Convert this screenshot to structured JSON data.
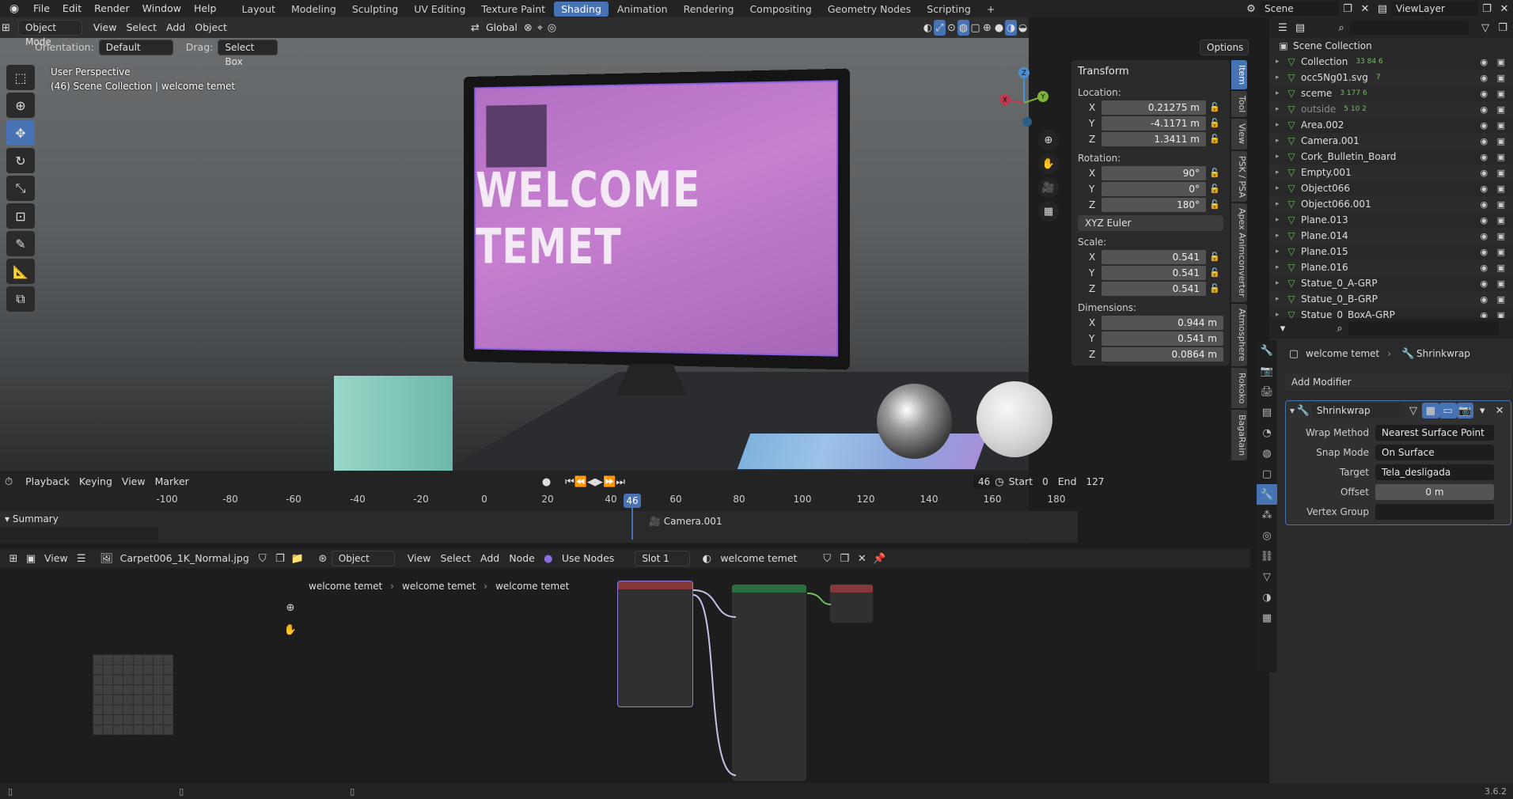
{
  "topbar": {
    "menus": [
      "File",
      "Edit",
      "Render",
      "Window",
      "Help"
    ],
    "workspaces": [
      "Layout",
      "Modeling",
      "Sculpting",
      "UV Editing",
      "Texture Paint",
      "Shading",
      "Animation",
      "Rendering",
      "Compositing",
      "Geometry Nodes",
      "Scripting"
    ],
    "active_workspace": "Shading",
    "scene": "Scene",
    "view_layer": "ViewLayer"
  },
  "viewport": {
    "mode": "Object Mode",
    "menus": [
      "View",
      "Select",
      "Add",
      "Object"
    ],
    "transform_space": "Global",
    "orientation_label": "Orientation:",
    "orientation_value": "Default",
    "drag_label": "Drag:",
    "drag_value": "Select Box",
    "options_label": "Options",
    "perspective": "User Perspective",
    "collection_info": "(46) Scene Collection | welcome temet",
    "screen_text": "WELCOME TEMET",
    "gizmo": {
      "x": "X",
      "y": "Y",
      "z": "Z"
    }
  },
  "npanel": {
    "title": "Transform",
    "location_label": "Location:",
    "location": {
      "x": "0.21275 m",
      "y": "-4.1171 m",
      "z": "1.3411 m"
    },
    "rotation_label": "Rotation:",
    "rotation": {
      "x": "90°",
      "y": "0°",
      "z": "180°"
    },
    "rotation_mode": "XYZ Euler",
    "scale_label": "Scale:",
    "scale": {
      "x": "0.541",
      "y": "0.541",
      "z": "0.541"
    },
    "dimensions_label": "Dimensions:",
    "dimensions": {
      "x": "0.944 m",
      "y": "0.541 m",
      "z": "0.0864 m"
    },
    "axis": {
      "x": "X",
      "y": "Y",
      "z": "Z"
    },
    "tabs": [
      "Item",
      "Tool",
      "View",
      "PSK / PSA",
      "Apex Animconverter",
      "Atmosphere",
      "Rokoko",
      "BagaRain"
    ],
    "active_tab": "Item"
  },
  "timeline": {
    "menus": [
      "Playback",
      "Keying",
      "View",
      "Marker"
    ],
    "current_frame": "46",
    "start_label": "Start",
    "start": "0",
    "end_label": "End",
    "end": "127",
    "ticks": [
      "-100",
      "-80",
      "-60",
      "-40",
      "-20",
      "0",
      "20",
      "40",
      "60",
      "80",
      "100",
      "120",
      "140",
      "160",
      "180"
    ],
    "summary": "Summary",
    "marker": "Camera.001"
  },
  "shader": {
    "menus": [
      "View"
    ],
    "image_name": "Carpet006_1K_Normal.jpg",
    "object_type": "Object",
    "node_menus": [
      "View",
      "Select",
      "Add",
      "Node"
    ],
    "use_nodes": "Use Nodes",
    "slot": "Slot 1",
    "material": "welcome temet",
    "breadcrumb": [
      "welcome temet",
      "welcome temet",
      "welcome temet"
    ]
  },
  "outliner": {
    "root": "Scene Collection",
    "items": [
      {
        "name": "Collection",
        "extra": "33 84 6"
      },
      {
        "name": "occ5Ng01.svg",
        "extra": "7"
      },
      {
        "name": "sceme",
        "extra": "3 177 6"
      },
      {
        "name": "outside",
        "extra": "5 10 2"
      },
      {
        "name": "Area.002",
        "extra": ""
      },
      {
        "name": "Camera.001",
        "extra": ""
      },
      {
        "name": "Cork_Bulletin_Board",
        "extra": ""
      },
      {
        "name": "Empty.001",
        "extra": ""
      },
      {
        "name": "Object066",
        "extra": ""
      },
      {
        "name": "Object066.001",
        "extra": ""
      },
      {
        "name": "Plane.013",
        "extra": ""
      },
      {
        "name": "Plane.014",
        "extra": ""
      },
      {
        "name": "Plane.015",
        "extra": ""
      },
      {
        "name": "Plane.016",
        "extra": ""
      },
      {
        "name": "Statue_0_A-GRP",
        "extra": ""
      },
      {
        "name": "Statue_0_B-GRP",
        "extra": ""
      },
      {
        "name": "Statue_0_BoxA-GRP",
        "extra": ""
      }
    ]
  },
  "properties": {
    "object": "welcome temet",
    "modifier_crumb": "Shrinkwrap",
    "add_modifier": "Add Modifier",
    "modifier_name": "Shrinkwrap",
    "wrap_method_label": "Wrap Method",
    "wrap_method": "Nearest Surface Point",
    "snap_mode_label": "Snap Mode",
    "snap_mode": "On Surface",
    "target_label": "Target",
    "target": "Tela_desligada",
    "offset_label": "Offset",
    "offset": "0 m",
    "vertex_group_label": "Vertex Group"
  },
  "status": {
    "version": "3.6.2"
  }
}
